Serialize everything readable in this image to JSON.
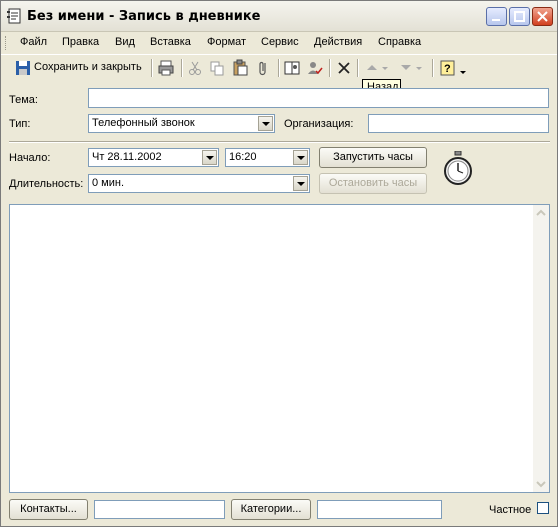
{
  "window": {
    "title": "Без имени - Запись в дневнике"
  },
  "menu": [
    "Файл",
    "Правка",
    "Вид",
    "Вставка",
    "Формат",
    "Сервис",
    "Действия",
    "Справка"
  ],
  "toolbar": {
    "save_label": "Сохранить и закрыть",
    "tooltip": "Назад"
  },
  "form": {
    "subject_label": "Тема:",
    "subject_value": "",
    "type_label": "Тип:",
    "type_value": "Телефонный звонок",
    "company_label": "Организация:",
    "company_value": "",
    "start_label": "Начало:",
    "start_date": "Чт 28.11.2002",
    "start_time": "16:20",
    "start_timer_button": "Запустить часы",
    "duration_label": "Длительность:",
    "duration_value": "0 мин.",
    "stop_timer_button": "Остановить часы"
  },
  "footer": {
    "contacts_button": "Контакты...",
    "contacts_value": "",
    "categories_button": "Категории...",
    "categories_value": "",
    "private_label": "Частное",
    "private_checked": false
  },
  "colors": {
    "window_bg": "#ece9d8",
    "input_border": "#7f9db9",
    "close_button": "#d1401f",
    "tooltip_bg": "#ffffe1"
  }
}
